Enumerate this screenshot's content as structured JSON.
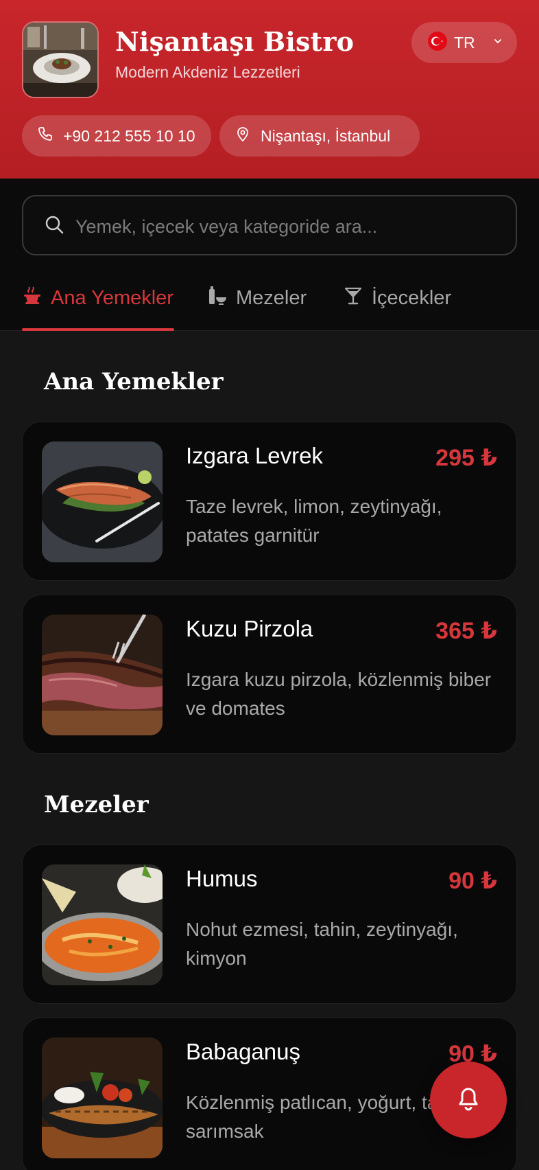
{
  "restaurant": {
    "name": "Nişantaşı Bistro",
    "tagline": "Modern Akdeniz Lezzetleri",
    "phone": "+90 212 555 10 10",
    "location": "Nişantaşı, İstanbul"
  },
  "language": {
    "code": "TR",
    "flag_icon": "turkey-flag-icon"
  },
  "search": {
    "placeholder": "Yemek, içecek veya kategoride ara..."
  },
  "tabs": [
    {
      "label": "Ana Yemekler",
      "icon": "cooking-pot-icon",
      "active": true
    },
    {
      "label": "Mezeler",
      "icon": "mortar-bottle-icon",
      "active": false
    },
    {
      "label": "İçecekler",
      "icon": "cocktail-glass-icon",
      "active": false
    }
  ],
  "sections": [
    {
      "title": "Ana Yemekler",
      "items": [
        {
          "name": "Izgara Levrek",
          "price": "295 ₺",
          "description": "Taze levrek, limon, zeytinyağı, patates garnitür"
        },
        {
          "name": "Kuzu Pirzola",
          "price": "365 ₺",
          "description": "Izgara kuzu pirzola, közlenmiş biber ve domates"
        }
      ]
    },
    {
      "title": "Mezeler",
      "items": [
        {
          "name": "Humus",
          "price": "90 ₺",
          "description": "Nohut ezmesi, tahin, zeytinyağı, kimyon"
        },
        {
          "name": "Babaganuş",
          "price": "90 ₺",
          "description": "Közlenmiş patlıcan, yoğurt, tahin, sarımsak"
        }
      ]
    }
  ],
  "colors": {
    "brand_red": "#c8262b",
    "accent": "#d7373c",
    "background": "#161616",
    "card": "#090909"
  },
  "fab": {
    "icon": "bell-icon"
  }
}
